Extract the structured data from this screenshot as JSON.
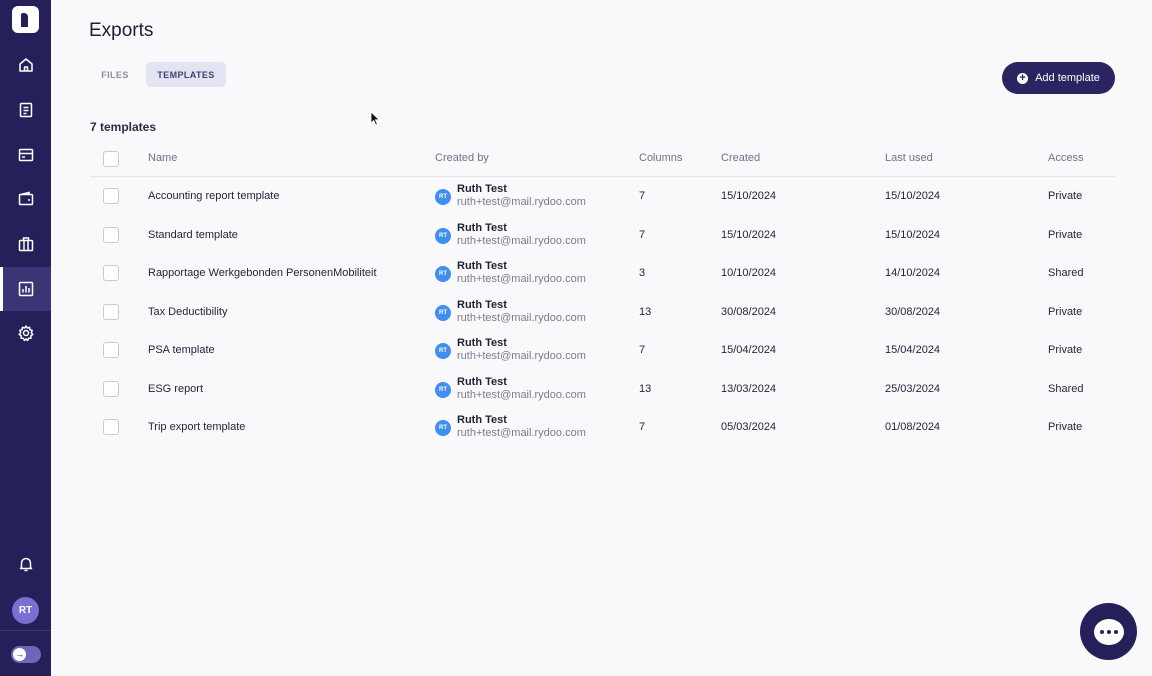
{
  "sidebar": {
    "items": [
      {
        "icon": "home-icon",
        "active": false
      },
      {
        "icon": "document-icon",
        "active": false
      },
      {
        "icon": "card-icon",
        "active": false
      },
      {
        "icon": "wallet-icon",
        "active": false
      },
      {
        "icon": "briefcase-icon",
        "active": false
      },
      {
        "icon": "reports-icon",
        "active": true
      },
      {
        "icon": "gear-icon",
        "active": false
      }
    ],
    "bell_icon": "bell-icon",
    "user_initials": "RT"
  },
  "page": {
    "title": "Exports",
    "tabs": [
      {
        "label": "FILES",
        "active": false
      },
      {
        "label": "TEMPLATES",
        "active": true
      }
    ],
    "add_button_label": "Add template",
    "count_label": "7 templates"
  },
  "table": {
    "headers": {
      "name": "Name",
      "created_by": "Created by",
      "columns": "Columns",
      "created": "Created",
      "last_used": "Last used",
      "access": "Access"
    },
    "rows": [
      {
        "name": "Accounting report template",
        "initials": "RT",
        "creator": "Ruth Test",
        "email": "ruth+test@mail.rydoo.com",
        "columns": "7",
        "created": "15/10/2024",
        "last_used": "15/10/2024",
        "access": "Private"
      },
      {
        "name": "Standard template",
        "initials": "RT",
        "creator": "Ruth Test",
        "email": "ruth+test@mail.rydoo.com",
        "columns": "7",
        "created": "15/10/2024",
        "last_used": "15/10/2024",
        "access": "Private"
      },
      {
        "name": "Rapportage Werkgebonden PersonenMobiliteit",
        "initials": "RT",
        "creator": "Ruth Test",
        "email": "ruth+test@mail.rydoo.com",
        "columns": "3",
        "created": "10/10/2024",
        "last_used": "14/10/2024",
        "access": "Shared"
      },
      {
        "name": "Tax Deductibility",
        "initials": "RT",
        "creator": "Ruth Test",
        "email": "ruth+test@mail.rydoo.com",
        "columns": "13",
        "created": "30/08/2024",
        "last_used": "30/08/2024",
        "access": "Private"
      },
      {
        "name": "PSA template",
        "initials": "RT",
        "creator": "Ruth Test",
        "email": "ruth+test@mail.rydoo.com",
        "columns": "7",
        "created": "15/04/2024",
        "last_used": "15/04/2024",
        "access": "Private"
      },
      {
        "name": "ESG report",
        "initials": "RT",
        "creator": "Ruth Test",
        "email": "ruth+test@mail.rydoo.com",
        "columns": "13",
        "created": "13/03/2024",
        "last_used": "25/03/2024",
        "access": "Shared"
      },
      {
        "name": "Trip export template",
        "initials": "RT",
        "creator": "Ruth Test",
        "email": "ruth+test@mail.rydoo.com",
        "columns": "7",
        "created": "05/03/2024",
        "last_used": "01/08/2024",
        "access": "Private"
      }
    ]
  },
  "colors": {
    "sidebar": "#25205a",
    "accent": "#2a2560",
    "creator_avatar": "#3f8ef0",
    "active_tab_bg": "#e3e4f2"
  }
}
